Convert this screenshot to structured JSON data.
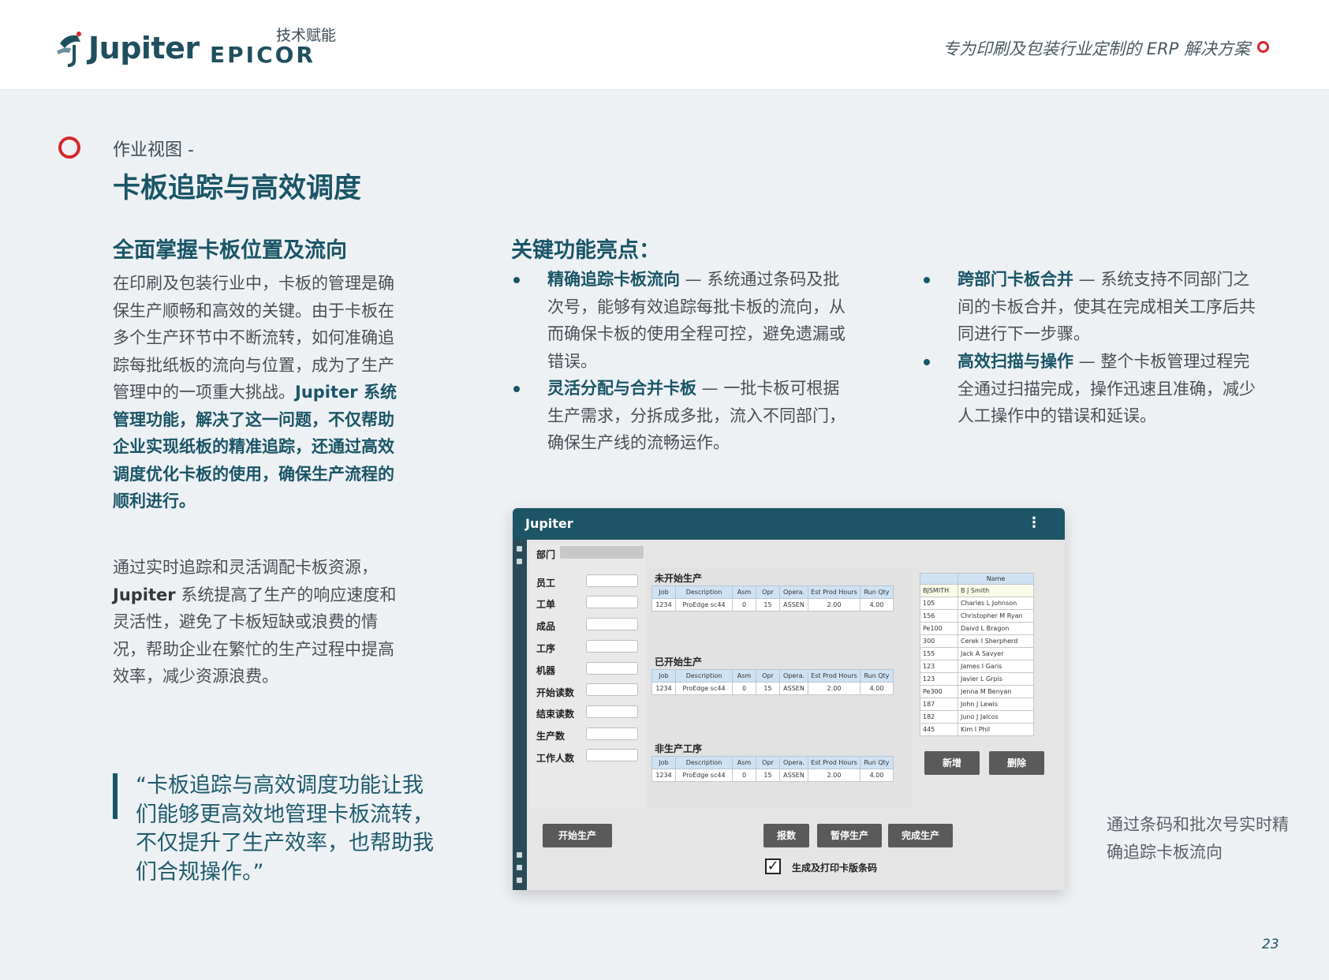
{
  "header": {
    "brand": "Jupiter",
    "partner_tag": "技术赋能",
    "partner": "EPICOR",
    "tagline": "专为印刷及包装行业定制的 ERP 解决方案"
  },
  "section": {
    "kicker": "作业视图 -",
    "title": "卡板追踪与高效调度"
  },
  "left": {
    "heading": "全面掌握卡板位置及流向",
    "p1_plain": "在印刷及包装行业中，卡板的管理是确保生产顺畅和高效的关键。由于卡板在多个生产环节中不断流转，如何准确追踪每批纸板的流向与位置，成为了生产管理中的一项重大挑战。",
    "p1_bold": "Jupiter 系统管理功能，解决了这一问题，不仅帮助企业实现纸板的精准追踪，还通过高效调度优化卡板的使用，确保生产流程的顺利进行。",
    "p2_pre": "通过实时追踪和灵活调配卡板资源，",
    "p2_bold": "Jupiter",
    "p2_post": " 系统提高了生产的响应速度和灵活性，避免了卡板短缺或浪费的情况，帮助企业在繁忙的生产过程中提高效率，减少资源浪费。",
    "quote": "“卡板追踪与高效调度功能让我们能够更高效地管理卡板流转，不仅提升了生产效率，也帮助我们合规操作。”"
  },
  "features": {
    "heading": "关键功能亮点：",
    "items": [
      {
        "title": "精确追踪卡板流向",
        "text": " — 系统通过条码及批次号，能够有效追踪每批卡板的流向，从而确保卡板的使用全程可控，避免遗漏或错误。"
      },
      {
        "title": "灵活分配与合并卡板",
        "text": " — 一批卡板可根据生产需求，分拆成多批，流入不同部门，确保生产线的流畅运作。"
      },
      {
        "title": "跨部门卡板合并",
        "text": " — 系统支持不同部门之间的卡板合并，使其在完成相关工序后共同进行下一步骤。"
      },
      {
        "title": "高效扫描与操作",
        "text": " — 整个卡板管理过程完全通过扫描完成，操作迅速且准确，减少人工操作中的错误和延误。"
      }
    ]
  },
  "app": {
    "logo": "Jupiter",
    "menu_icon": "⋮",
    "dept_label": "部门",
    "fields": [
      "员工",
      "工单",
      "成品",
      "工序",
      "机器",
      "开始读数",
      "结束读数",
      "生产数",
      "工作人数"
    ],
    "grids": [
      {
        "title": "未开始生产"
      },
      {
        "title": "已开始生产"
      },
      {
        "title": "非生产工序"
      }
    ],
    "grid_columns": [
      "Job",
      "Description",
      "Asm",
      "Opr",
      "Opera.",
      "Est Prod Hours",
      "Run Qty"
    ],
    "grid_row": [
      "1234",
      "ProEdge sc44",
      "0",
      "15",
      "ASSEN",
      "2.00",
      "4.00"
    ],
    "name_header": "Name",
    "names": [
      [
        "BJSMITH",
        "B J Smith"
      ],
      [
        "105",
        "Charles L Johnson"
      ],
      [
        "156",
        "Christopher M Ryan"
      ],
      [
        "Pe100",
        "Daivd L Bragon"
      ],
      [
        "300",
        "Cerek I Sherpherd"
      ],
      [
        "155",
        "Jack A Savyer"
      ],
      [
        "123",
        "James I Garis"
      ],
      [
        "123",
        "Javier L Grpis"
      ],
      [
        "Pe300",
        "Jenna M Benyan"
      ],
      [
        "187",
        "John J Lewis"
      ],
      [
        "182",
        "Juno J Jalcos"
      ],
      [
        "445",
        "Kim I Phil"
      ]
    ],
    "btn_add": "新增",
    "btn_delete": "删除",
    "btn_start": "开始生产",
    "btn_scrap": "报数",
    "btn_pause": "暂停生产",
    "btn_finish": "完成生产",
    "checkbox_mark": "✓",
    "checkbox_label": "生成及打印卡版条码"
  },
  "caption": "通过条码和批次号实时精确追踪卡板流向",
  "page_number": "23",
  "colors": {
    "accent": "#1a5566",
    "ring": "#d6262a",
    "page_bg": "#eef1f4"
  }
}
